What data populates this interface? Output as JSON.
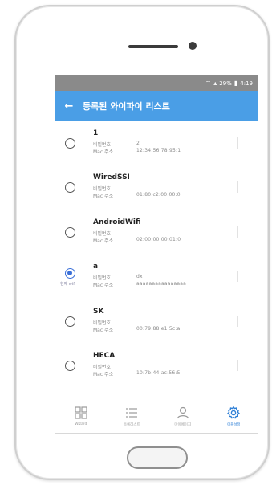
{
  "statusbar": {
    "icons": [
      "wifi-icon",
      "signal-icon",
      "battery-icon"
    ],
    "battery": "29%",
    "time": "4:19"
  },
  "appbar": {
    "back_icon": "back-arrow-icon",
    "title": "등록된 와이파이 리스트"
  },
  "labels": {
    "password": "비밀번호",
    "mac": "Mac 주소"
  },
  "wifi_list": [
    {
      "ssid": "1",
      "password": "2",
      "mac": "12:34:56:78:95:1",
      "selected": false,
      "caption": ""
    },
    {
      "ssid": "WiredSSI",
      "password": "",
      "mac": "01:80:c2:00:00:0",
      "selected": false,
      "caption": ""
    },
    {
      "ssid": "AndroidWifi",
      "password": "",
      "mac": "02:00:00:00:01:0",
      "selected": false,
      "caption": ""
    },
    {
      "ssid": "a",
      "password": "dx",
      "mac": "aaaaaaaaaaaaaaaa",
      "selected": true,
      "caption": "현재 wifi"
    },
    {
      "ssid": "SK",
      "password": "",
      "mac": "00:79:88:e1:5c:a",
      "selected": false,
      "caption": ""
    },
    {
      "ssid": "HECA",
      "password": "",
      "mac": "10:7b:44:ac:56:5",
      "selected": false,
      "caption": ""
    }
  ],
  "bottom_nav": [
    {
      "label": "Wizard",
      "icon": "grid-icon",
      "active": false
    },
    {
      "label": "등록리스트",
      "icon": "list-icon",
      "active": false
    },
    {
      "label": "마이페이지",
      "icon": "user-icon",
      "active": false
    },
    {
      "label": "어플설정",
      "icon": "gear-icon",
      "active": true
    }
  ],
  "colors": {
    "appbar": "#4a9ee6",
    "statusbar": "#8a8a8a",
    "accent": "#3a6fd8",
    "nav_active": "#2e7fd6"
  }
}
